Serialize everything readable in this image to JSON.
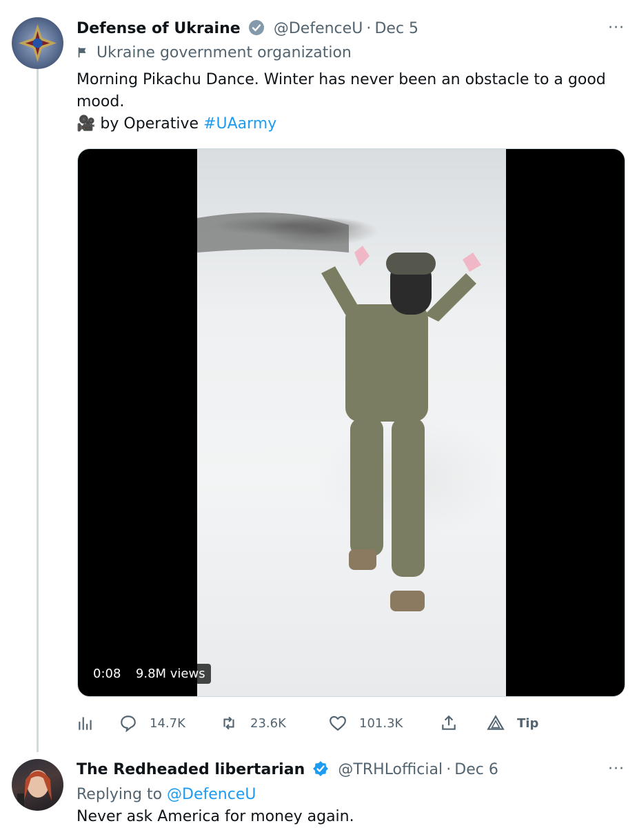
{
  "tweet1": {
    "name": "Defense of Ukraine",
    "handle": "@DefenceU",
    "sep": "·",
    "date": "Dec 5",
    "label": "Ukraine government organization",
    "text_line": "Morning Pikachu Dance. Winter has never been an obstacle to a good mood.",
    "credit_emoji": "🎥",
    "credit_text": "by Operative",
    "hashtag": "#UAarmy",
    "video": {
      "time": "0:08",
      "views": "9.8M views"
    },
    "stats": {
      "replies": "14.7K",
      "retweets": "23.6K",
      "likes": "101.3K",
      "tip": "Tip"
    },
    "more": "···"
  },
  "tweet2": {
    "name": "The Redheaded libertarian",
    "handle": "@TRHLofficial",
    "sep": "·",
    "date": "Dec 6",
    "replying_label": "Replying to",
    "replying_handle": "@DefenceU",
    "text": "Never ask America for money again.",
    "more": "···"
  },
  "icons": [
    "verified-badge-icon",
    "flag-icon",
    "analytics-icon",
    "reply-icon",
    "retweet-icon",
    "like-icon",
    "share-icon",
    "tip-icon",
    "more-icon"
  ],
  "colors": {
    "link": "#1d9bf0",
    "muted": "#536471",
    "text": "#0f1419",
    "badge": "#1d9bf0"
  }
}
